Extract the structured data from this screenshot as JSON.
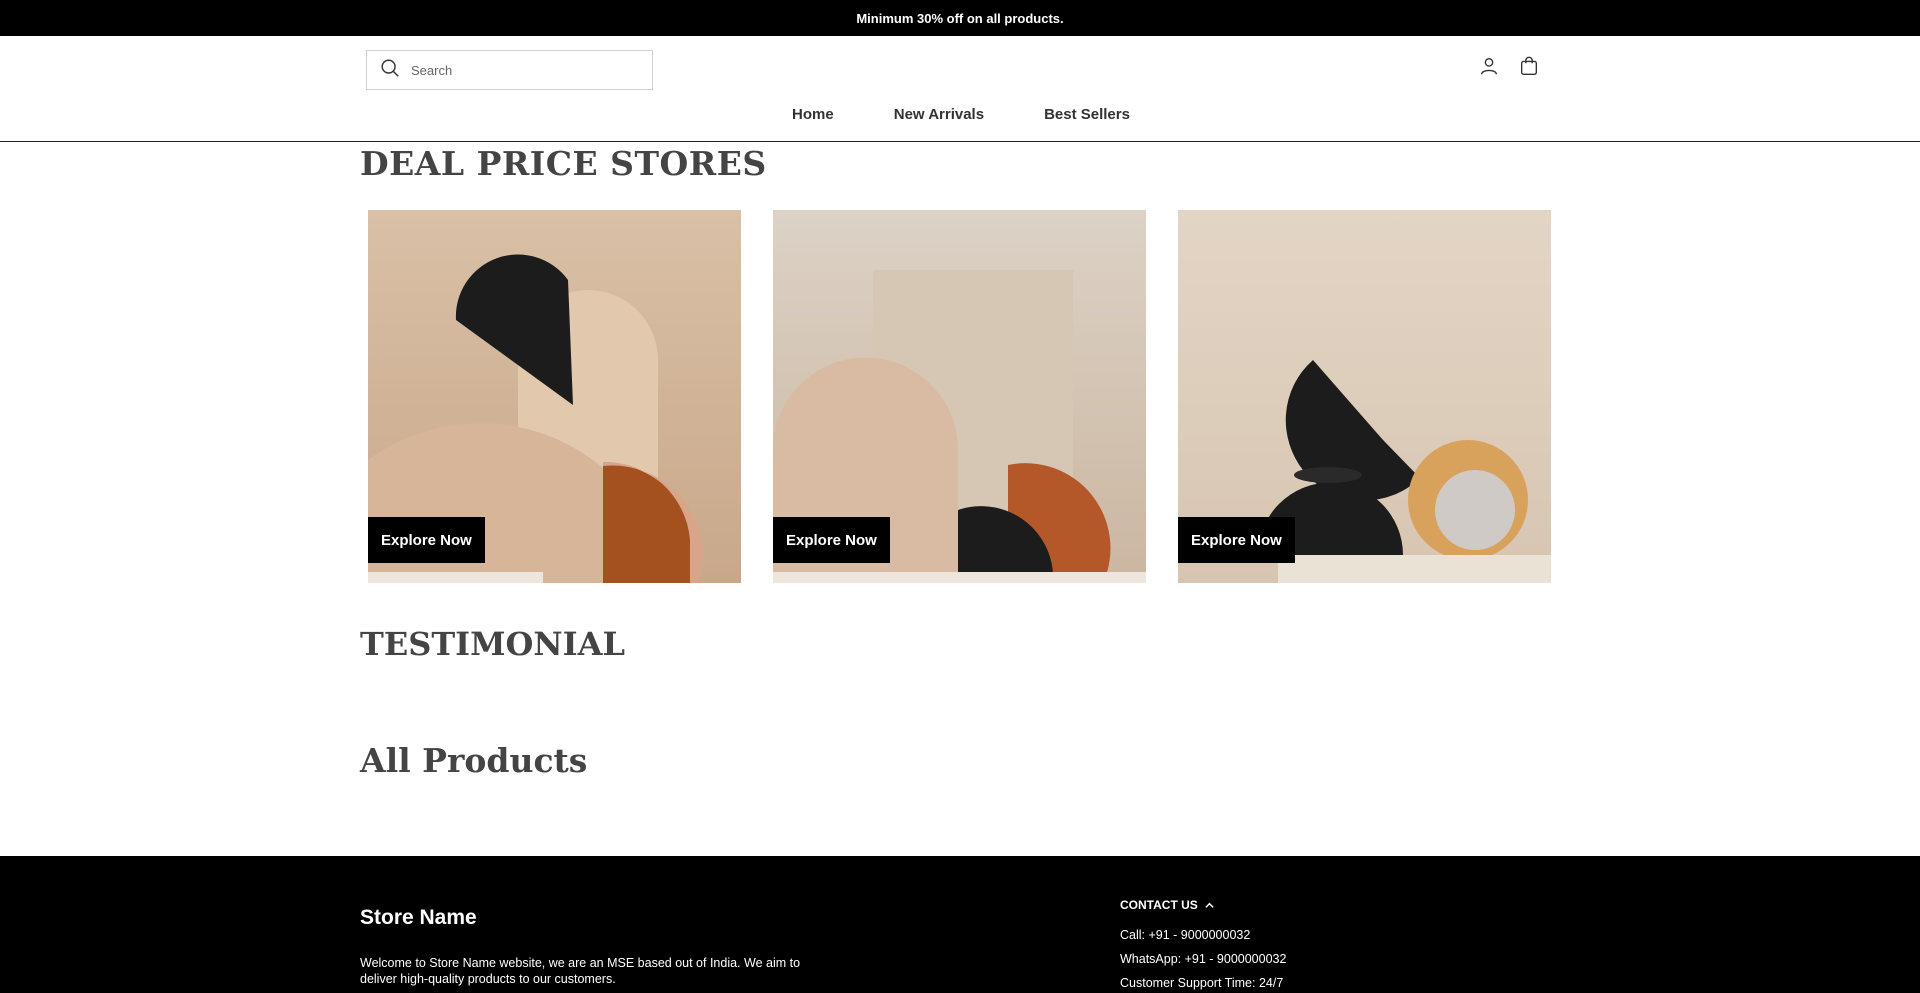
{
  "announcement": {
    "text": "Minimum 30% off on all products."
  },
  "header": {
    "search": {
      "placeholder": "Search"
    },
    "icons": [
      "user-icon",
      "shopping-bag-icon",
      "search-icon"
    ],
    "nav": [
      {
        "label": "Home"
      },
      {
        "label": "New Arrivals"
      },
      {
        "label": "Best Sellers"
      }
    ]
  },
  "deal_section": {
    "title": "DEAL PRICE STORES",
    "cards": [
      {
        "button_label": "Explore Now"
      },
      {
        "button_label": "Explore Now"
      },
      {
        "button_label": "Explore Now"
      }
    ]
  },
  "testimonial_section": {
    "title": "TESTIMONIAL"
  },
  "products_section": {
    "title": "All Products"
  },
  "footer": {
    "store_name": "Store Name",
    "description": "Welcome to Store Name website, we are an MSE based out of India. We aim to deliver high-quality products to our customers.",
    "contact": {
      "heading": "CONTACT US",
      "lines": [
        "Call: +91 - 9000000032",
        "WhatsApp: +91 - 9000000032",
        "Customer Support Time: 24/7"
      ]
    }
  },
  "colors": {
    "announcement_bg": "#000000",
    "footer_bg": "#000000",
    "button_bg": "#000000",
    "heading_text": "#444444",
    "card_beige": "#d9c2ad",
    "card_rust": "#b4582a",
    "card_black": "#1c1c1c",
    "card_mustard": "#d9a25c"
  }
}
